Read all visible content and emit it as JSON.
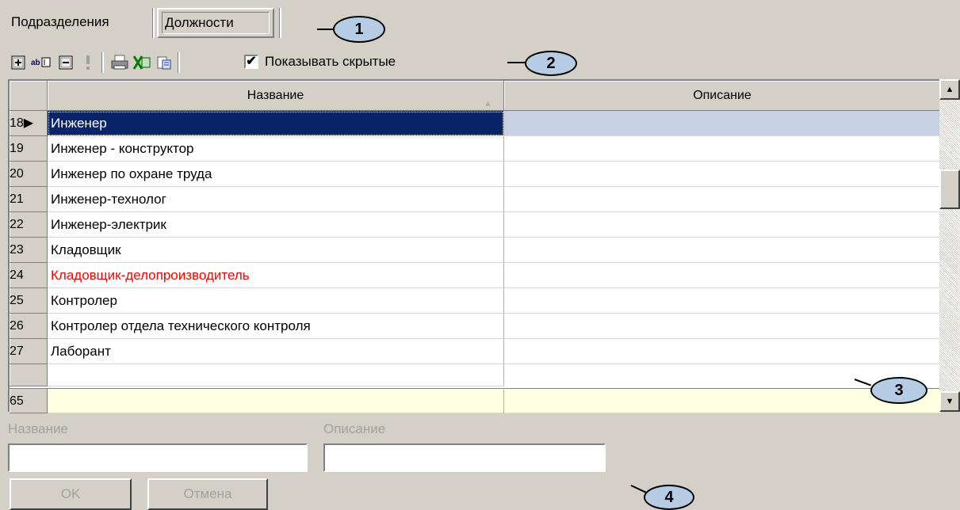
{
  "tabs": {
    "divisions": "Подразделения",
    "positions": "Должности"
  },
  "callouts": [
    "1",
    "2",
    "3",
    "4"
  ],
  "toolbar": {
    "show_hidden_label": "Показывать скрытые",
    "show_hidden_checked": true,
    "check_mark": "✔"
  },
  "grid": {
    "columns": [
      "Название",
      "Описание"
    ],
    "sort_indicator": "▲",
    "rows": [
      {
        "num": "18",
        "marker": "▶",
        "name": "Инженер",
        "desc": ""
      },
      {
        "num": "19",
        "marker": "",
        "name": "Инженер - конструктор",
        "desc": ""
      },
      {
        "num": "20",
        "marker": "",
        "name": "Инженер по охране труда",
        "desc": ""
      },
      {
        "num": "21",
        "marker": "",
        "name": "Инженер-технолог",
        "desc": ""
      },
      {
        "num": "22",
        "marker": "",
        "name": "Инженер-электрик",
        "desc": ""
      },
      {
        "num": "23",
        "marker": "",
        "name": "Кладовщик",
        "desc": ""
      },
      {
        "num": "24",
        "marker": "",
        "name": "Кладовщик-делопроизводитель",
        "desc": ""
      },
      {
        "num": "25",
        "marker": "",
        "name": "Контролер",
        "desc": ""
      },
      {
        "num": "26",
        "marker": "",
        "name": "Контролер отдела технического контроля",
        "desc": ""
      },
      {
        "num": "27",
        "marker": "",
        "name": "Лаборант",
        "desc": ""
      }
    ],
    "new_row_num": "65"
  },
  "form": {
    "name_label": "Название",
    "desc_label": "Описание",
    "name_value": "",
    "desc_value": "",
    "ok_label": "OK",
    "cancel_label": "Отмена"
  },
  "colors": {
    "selection": "#0a246a",
    "hidden_item": "#ff0000",
    "new_row": "#ffffe1",
    "callout": "#b6cbe4"
  }
}
